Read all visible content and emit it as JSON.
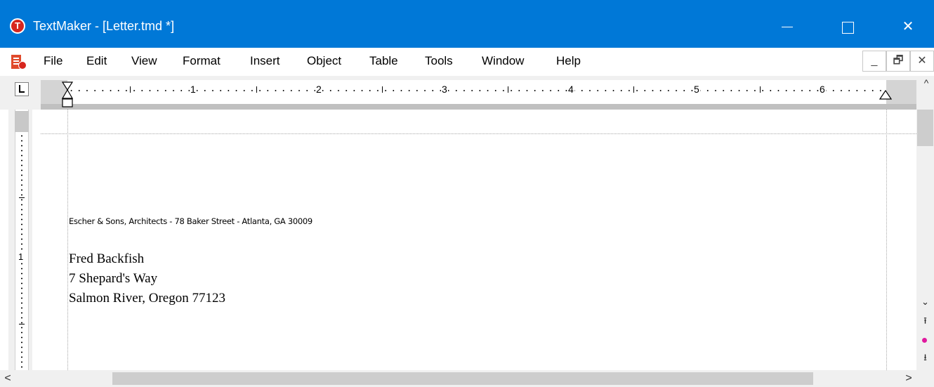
{
  "window": {
    "title": "TextMaker - [Letter.tmd *]",
    "app_icon_letter": "T",
    "minimize_label": "",
    "maximize_label": "",
    "close_label": "✕",
    "accent_color": "#0078d7"
  },
  "menu": {
    "items": [
      "File",
      "Edit",
      "View",
      "Format",
      "Insert",
      "Object",
      "Table",
      "Tools",
      "Window",
      "Help"
    ],
    "doc_minimize": "_",
    "doc_restore": "🗗",
    "doc_close": "✕"
  },
  "ruler": {
    "numbers": [
      "1",
      "2",
      "3",
      "4",
      "5",
      "6"
    ],
    "vertical_number": "1"
  },
  "document": {
    "sender_line": "Escher & Sons, Architects - 78 Baker Street - Atlanta, GA 30009",
    "recipient": {
      "name": "Fred Backfish",
      "street": "7 Shepard's Way",
      "city": "Salmon River, Oregon 77123"
    }
  },
  "scrollbars": {
    "up_arrow": "^",
    "down_arrow": "⌄",
    "prev_page": "⭱",
    "next_page": "⭳",
    "left_arrow": "<",
    "right_arrow": ">",
    "browse_object_color": "#e0199e"
  }
}
